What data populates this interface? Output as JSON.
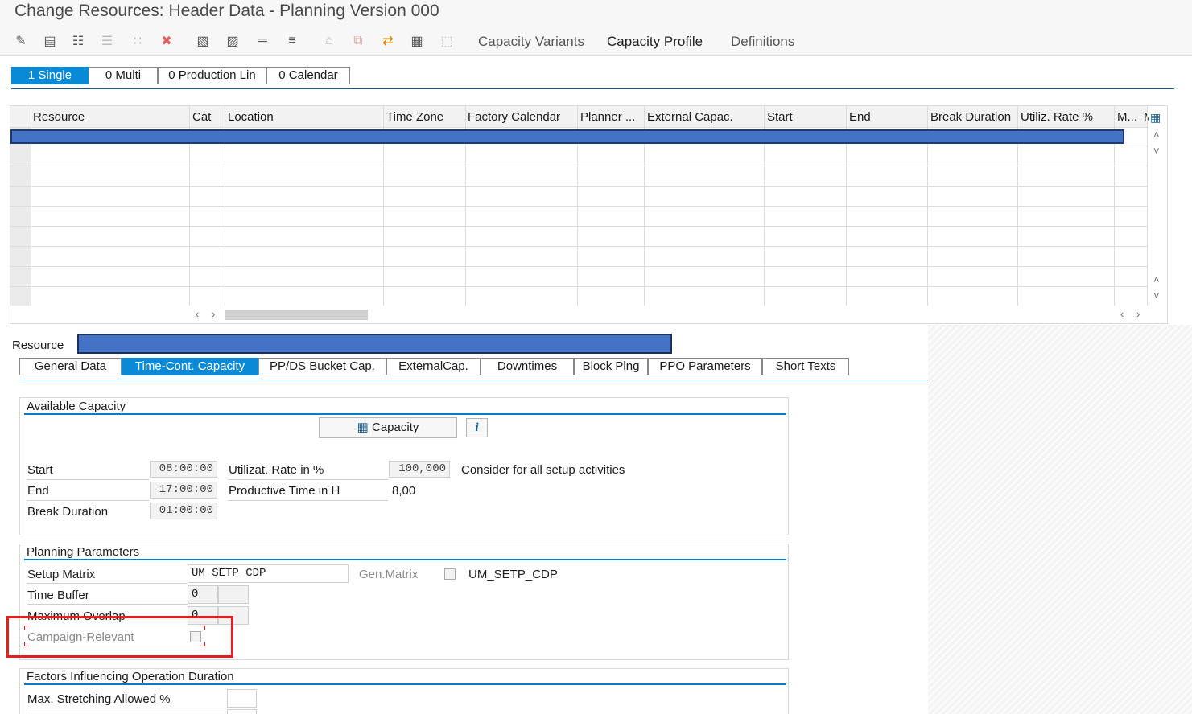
{
  "window": {
    "title": "Change Resources: Header Data - Planning Version 000"
  },
  "toolbar": {
    "icons": [
      "display-change-icon",
      "table-icon",
      "layout-icon",
      "details-icon",
      "hierarchy-icon",
      "delete-icon",
      "select-icon",
      "deselect-icon",
      "align-icon",
      "filter-icon",
      "trash-icon",
      "copy-icon",
      "share-icon",
      "grid-settings-icon",
      "apps-icon"
    ],
    "links": [
      "Capacity Variants",
      "Capacity Profile",
      "Definitions"
    ]
  },
  "top_tabs": [
    "1 Single",
    "0 Multi",
    "0 Production Lin",
    "0 Calendar"
  ],
  "grid": {
    "columns": [
      "Resource",
      "Cat",
      "Location",
      "Time Zone",
      "Factory Calendar",
      "Planner ...",
      "External Capac.",
      "Start",
      "End",
      "Break Duration",
      "Utiliz. Rate %",
      "M...",
      "M"
    ]
  },
  "resource": {
    "label": "Resource",
    "value": ""
  },
  "sub_tabs": [
    "General Data",
    "Time-Cont. Capacity",
    "PP/DS Bucket Cap.",
    "ExternalCap.",
    "Downtimes",
    "Block Plng",
    "PPO Parameters",
    "Short Texts"
  ],
  "available_capacity": {
    "title": "Available Capacity",
    "capacity_button": "Capacity",
    "info_icon": "i",
    "start_label": "Start",
    "start_value": "08:00:00",
    "end_label": "End",
    "end_value": "17:00:00",
    "break_label": "Break Duration",
    "break_value": "01:00:00",
    "util_label": "Utilizat. Rate in %",
    "util_value": "100,000",
    "consider_text": "Consider for all setup activities",
    "productive_label": "Productive Time in H",
    "productive_value": "8,00"
  },
  "planning_parameters": {
    "title": "Planning Parameters",
    "setup_matrix_label": "Setup Matrix",
    "setup_matrix_value": "UM_SETP_CDP",
    "gen_matrix_label": "Gen.Matrix",
    "gen_matrix_text": "UM_SETP_CDP",
    "time_buffer_label": "Time Buffer",
    "time_buffer_value": "0",
    "max_overlap_label": "Maximum Overlap",
    "max_overlap_value": "0",
    "campaign_label": "Campaign-Relevant"
  },
  "factors": {
    "title": "Factors Influencing Operation Duration",
    "max_stretch_label": "Max. Stretching Allowed %"
  },
  "colors": {
    "accent": "#0a8ad6",
    "selection": "#4472c4",
    "highlight": "#e02020"
  }
}
